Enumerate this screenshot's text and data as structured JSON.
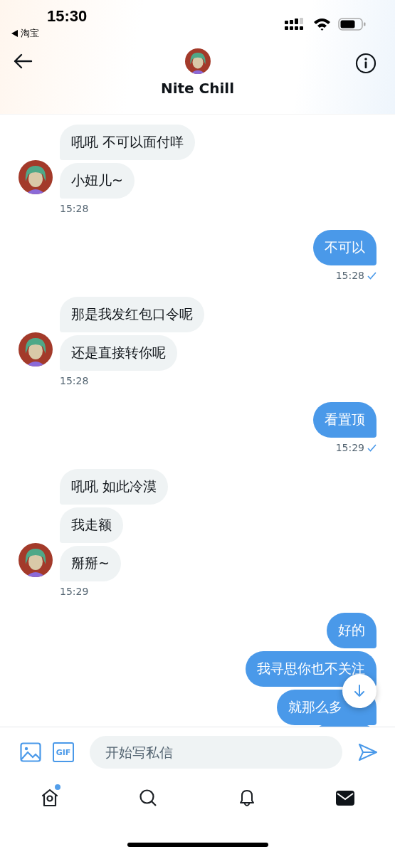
{
  "status_bar": {
    "time": "15:30",
    "back_app": "淘宝"
  },
  "header": {
    "name": "Nite Chill"
  },
  "groups": [
    {
      "kind": "in",
      "bubbles": [
        "吼吼 不可以面付咩",
        "小妞儿~"
      ],
      "time": "15:28"
    },
    {
      "kind": "out",
      "bubbles": [
        "不可以"
      ],
      "time": "15:28",
      "read": true
    },
    {
      "kind": "in",
      "bubbles": [
        "那是我发红包口令呢",
        "还是直接转你呢"
      ],
      "time": "15:28"
    },
    {
      "kind": "out",
      "bubbles": [
        "看置顶"
      ],
      "time": "15:29",
      "read": true
    },
    {
      "kind": "in",
      "bubbles": [
        "吼吼 如此冷漠",
        "我走额",
        "掰掰~"
      ],
      "time": "15:29"
    },
    {
      "kind": "out",
      "bubbles": [
        "好的",
        "我寻思你也不关注",
        "就那么多"
      ],
      "last_covered": true
    }
  ],
  "composer": {
    "gif_label": "GIF",
    "placeholder": "开始写私信"
  },
  "nav": [
    {
      "kind": "home",
      "selected": false,
      "badge": true
    },
    {
      "kind": "search",
      "selected": false,
      "badge": false
    },
    {
      "kind": "bell",
      "selected": false,
      "badge": false
    },
    {
      "kind": "mail",
      "selected": true,
      "badge": false
    }
  ]
}
